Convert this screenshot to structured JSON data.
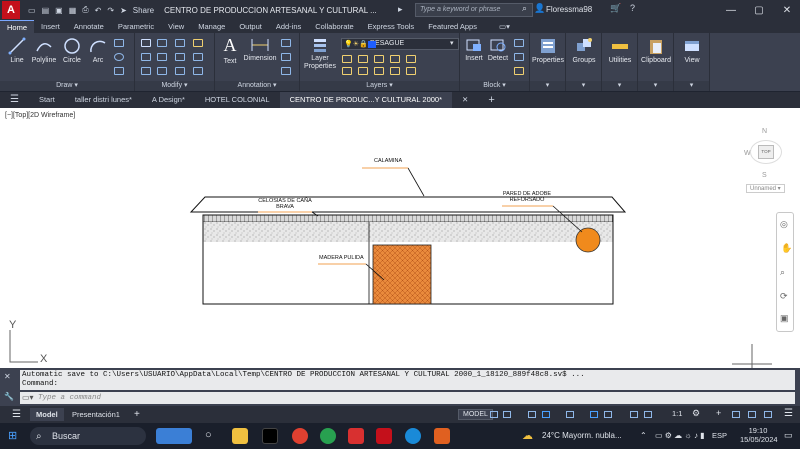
{
  "app": {
    "logo_letter": "A",
    "title": "CENTRO DE PRODUCCION ARTESANAL Y CULTURAL ...",
    "share_label": "Share",
    "search_placeholder": "Type a keyword or phrase",
    "user": "Floressma98"
  },
  "ribbon_tabs": [
    "Home",
    "Insert",
    "Annotate",
    "Parametric",
    "View",
    "Manage",
    "Output",
    "Add-ins",
    "Collaborate",
    "Express Tools",
    "Featured Apps"
  ],
  "ribbon": {
    "draw_tools": [
      "Line",
      "Polyline",
      "Circle",
      "Arc"
    ],
    "text_label": "Text",
    "dimension_label": "Dimension",
    "layer_properties_label": "Layer Properties",
    "layer_current": "DESAGUE",
    "insert_label": "Insert",
    "detect_label": "Detect",
    "big_tools": [
      "Properties",
      "Groups",
      "Utilities",
      "Clipboard",
      "View"
    ],
    "panel_labels": {
      "draw": "Draw ▾",
      "modify": "Modify ▾",
      "annotation": "Annotation ▾",
      "layers": "Layers ▾",
      "block": "Block ▾"
    }
  },
  "file_tabs": {
    "start": "Start",
    "tabs": [
      "taller distri lunes*",
      "A Design*",
      "HOTEL COLONIAL",
      "CENTRO DE PRODUC...Y CULTURAL 2000*"
    ]
  },
  "viewport": {
    "label": "[−][Top][2D Wireframe]",
    "viewcube": {
      "n": "N",
      "w": "W",
      "s": "S",
      "face": "TOP",
      "wcs": "Unnamed ▾"
    }
  },
  "drawing": {
    "annotations": {
      "calamina": "CALAMINA",
      "celosias_line1": "CELOSIAS DE CAÑA",
      "celosias_line2": "BRAVA",
      "pared_line1": "PARED DE ADOBE",
      "pared_line2": "REFORSADO",
      "madera": "MADERA PULIDA"
    },
    "ucs_y": "Y",
    "ucs_x": "X",
    "colors": {
      "door": "#e98a3c",
      "circle": "#f08a1c",
      "leader": "#f0a050"
    }
  },
  "command": {
    "history_line1": "Automatic save to C:\\Users\\USUARIO\\AppData\\Local\\Temp\\CENTRO DE PRODUCCION ARTESANAL Y CULTURAL 2000_1_18120_889f48c8.sv$ ...",
    "history_line2": "Command:",
    "input_placeholder": "Type a command"
  },
  "layout_tabs": {
    "model": "Model",
    "layout1": "Presentación1"
  },
  "status": {
    "model": "MODEL",
    "scale": "1:1"
  },
  "taskbar": {
    "search": "Buscar",
    "weather": "24°C  Mayorm. nubla...",
    "lang": "ESP",
    "time": "19:10",
    "date": "15/05/2024"
  }
}
